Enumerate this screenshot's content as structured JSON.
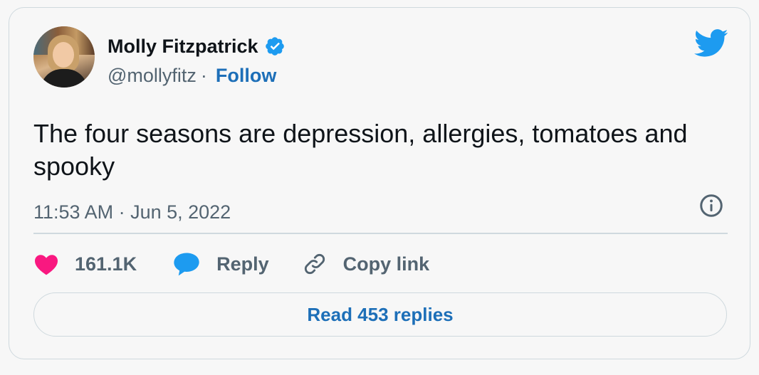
{
  "author": {
    "name": "Molly Fitzpatrick",
    "handle": "@mollyfitz",
    "separator": "·",
    "follow_label": "Follow",
    "avatar_icon": "profile-photo",
    "verified_icon": "verified-badge-icon"
  },
  "tweet": {
    "text": "The four seasons are depression, allergies, tomatoes and spooky",
    "timestamp": "11:53 AM · Jun 5, 2022"
  },
  "actions": {
    "likes": "161.1K",
    "reply_label": "Reply",
    "copy_link_label": "Copy link"
  },
  "footer": {
    "read_replies_label": "Read 453 replies"
  },
  "colors": {
    "brand_blue": "#1d9bf0",
    "link_blue": "#1d6fb8",
    "heart_pink": "#f91880",
    "text_primary": "#0f1419",
    "text_secondary": "#536471",
    "border": "#cfd9de"
  }
}
